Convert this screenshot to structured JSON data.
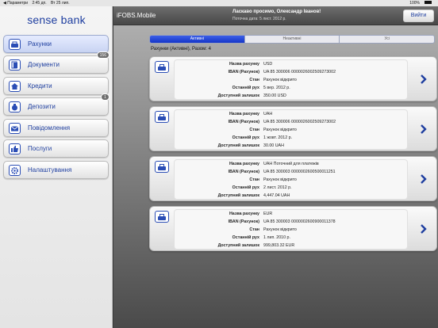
{
  "status_bar": {
    "back": "◀ Параметри",
    "time": "2:45 дп.",
    "date": "Вт 25 лип.",
    "battery": "100%"
  },
  "sidebar": {
    "logo": "sense bank",
    "items": [
      {
        "label": "Рахунки",
        "icon": "wallet-icon",
        "active": true,
        "badge": ""
      },
      {
        "label": "Документи",
        "icon": "documents-icon",
        "active": false,
        "badge": "156"
      },
      {
        "label": "Кредити",
        "icon": "house-icon",
        "active": false,
        "badge": ""
      },
      {
        "label": "Депозити",
        "icon": "moneybag-icon",
        "active": false,
        "badge": "1"
      },
      {
        "label": "Повідомлення",
        "icon": "mail-icon",
        "active": false,
        "badge": ""
      },
      {
        "label": "Послуги",
        "icon": "thumbs-up-icon",
        "active": false,
        "badge": ""
      },
      {
        "label": "Налаштування",
        "icon": "gear-icon",
        "active": false,
        "badge": ""
      }
    ]
  },
  "header": {
    "app_title": "iFOBS.Mobile",
    "welcome": "Ласкаво просимо, Олександр Іванов!",
    "subinfo": "Поточна дата: 5 лист. 2012 р.",
    "logout": "Вийти"
  },
  "tabs": [
    {
      "label": "Активні",
      "active": true
    },
    {
      "label": "Неактивні",
      "active": false
    },
    {
      "label": "Усі",
      "active": false
    }
  ],
  "list_title": "Рахунки (Активні), Разом: 4",
  "field_labels": {
    "name": "Назва рахунку",
    "iban": "IBAN (Рахунок)",
    "state": "Стан",
    "last_move": "Останній рух",
    "balance": "Доступний залишок"
  },
  "accounts": [
    {
      "name": "USD",
      "iban": "UA 85 300006 0000026002509273002",
      "state": "Рахунок відкрито",
      "last_move": "5 вер. 2012 р.",
      "balance": "350.00  USD"
    },
    {
      "name": "UAH",
      "iban": "UA 85 300006 0000026002509273002",
      "state": "Рахунок відкрито",
      "last_move": "1 жовт. 2012 р.",
      "balance": "30.00  UAH"
    },
    {
      "name": "UAH Поточний для платежів",
      "iban": "UA 85 300003 0000002600500011251",
      "state": "Рахунок відкрито",
      "last_move": "2 лист. 2012 р.",
      "balance": "4,447.04  UAH"
    },
    {
      "name": "EUR",
      "iban": "UA 85 300003 0000002600900011378",
      "state": "Рахунок відкрито",
      "last_move": "1 лип. 2010 р.",
      "balance": "999,803.32  EUR"
    }
  ],
  "colors": {
    "accent": "#1f3fa0",
    "tab_active": "#1536c8"
  }
}
